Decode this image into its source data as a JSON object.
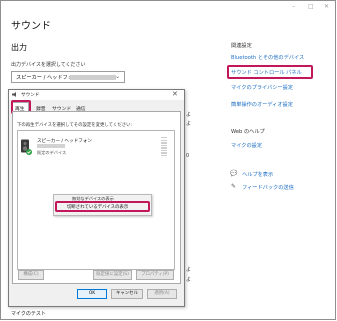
{
  "window": {
    "title": "サウンド",
    "minimize_glyph": "–",
    "maximize_glyph": "□",
    "close_glyph": "✕"
  },
  "output": {
    "heading": "出力",
    "select_label": "出力デバイスを選択してください",
    "device_value": "スピーカー / ヘッドフォン"
  },
  "related": {
    "heading": "関連設定",
    "links": [
      "Bluetooth とその他のデバイス",
      "サウンド コントロール パネル",
      "マイクのプライバシー設定",
      "簡単操作のオーディオ設定"
    ]
  },
  "web_help": {
    "heading": "Web のヘルプ",
    "link": "マイクの設定"
  },
  "support": {
    "help_link": "ヘルプを表示",
    "feedback_link": "フィードバックの送信"
  },
  "background_fragments": {
    "right_a": "よ",
    "right_b": "よ",
    "right_num": "0",
    "right_c": "よ",
    "right_d": "よ",
    "bottom": "マイクのテスト"
  },
  "dialog": {
    "title": "サウンド",
    "close_glyph": "✕",
    "tabs": [
      "再生",
      "録音",
      "サウンド",
      "通信"
    ],
    "instruction": "下の再生デバイスを選択してその設定を変更してください:",
    "device": {
      "name": "スピーカー / ヘッドフォン",
      "status": "既定のデバイス"
    },
    "context_menu": {
      "items": [
        "無効なデバイスの表示",
        "切断されているデバイスの表示"
      ]
    },
    "buttons": {
      "configure": "構成(C)",
      "set_default": "既定値に設定(S)",
      "properties": "プロパティ(P)",
      "ok": "OK",
      "cancel": "キャンセル",
      "apply": "適用(A)"
    }
  },
  "colors": {
    "highlight": "#c2185b",
    "link": "#1d6fc4",
    "default_check": "#2e9e44"
  }
}
